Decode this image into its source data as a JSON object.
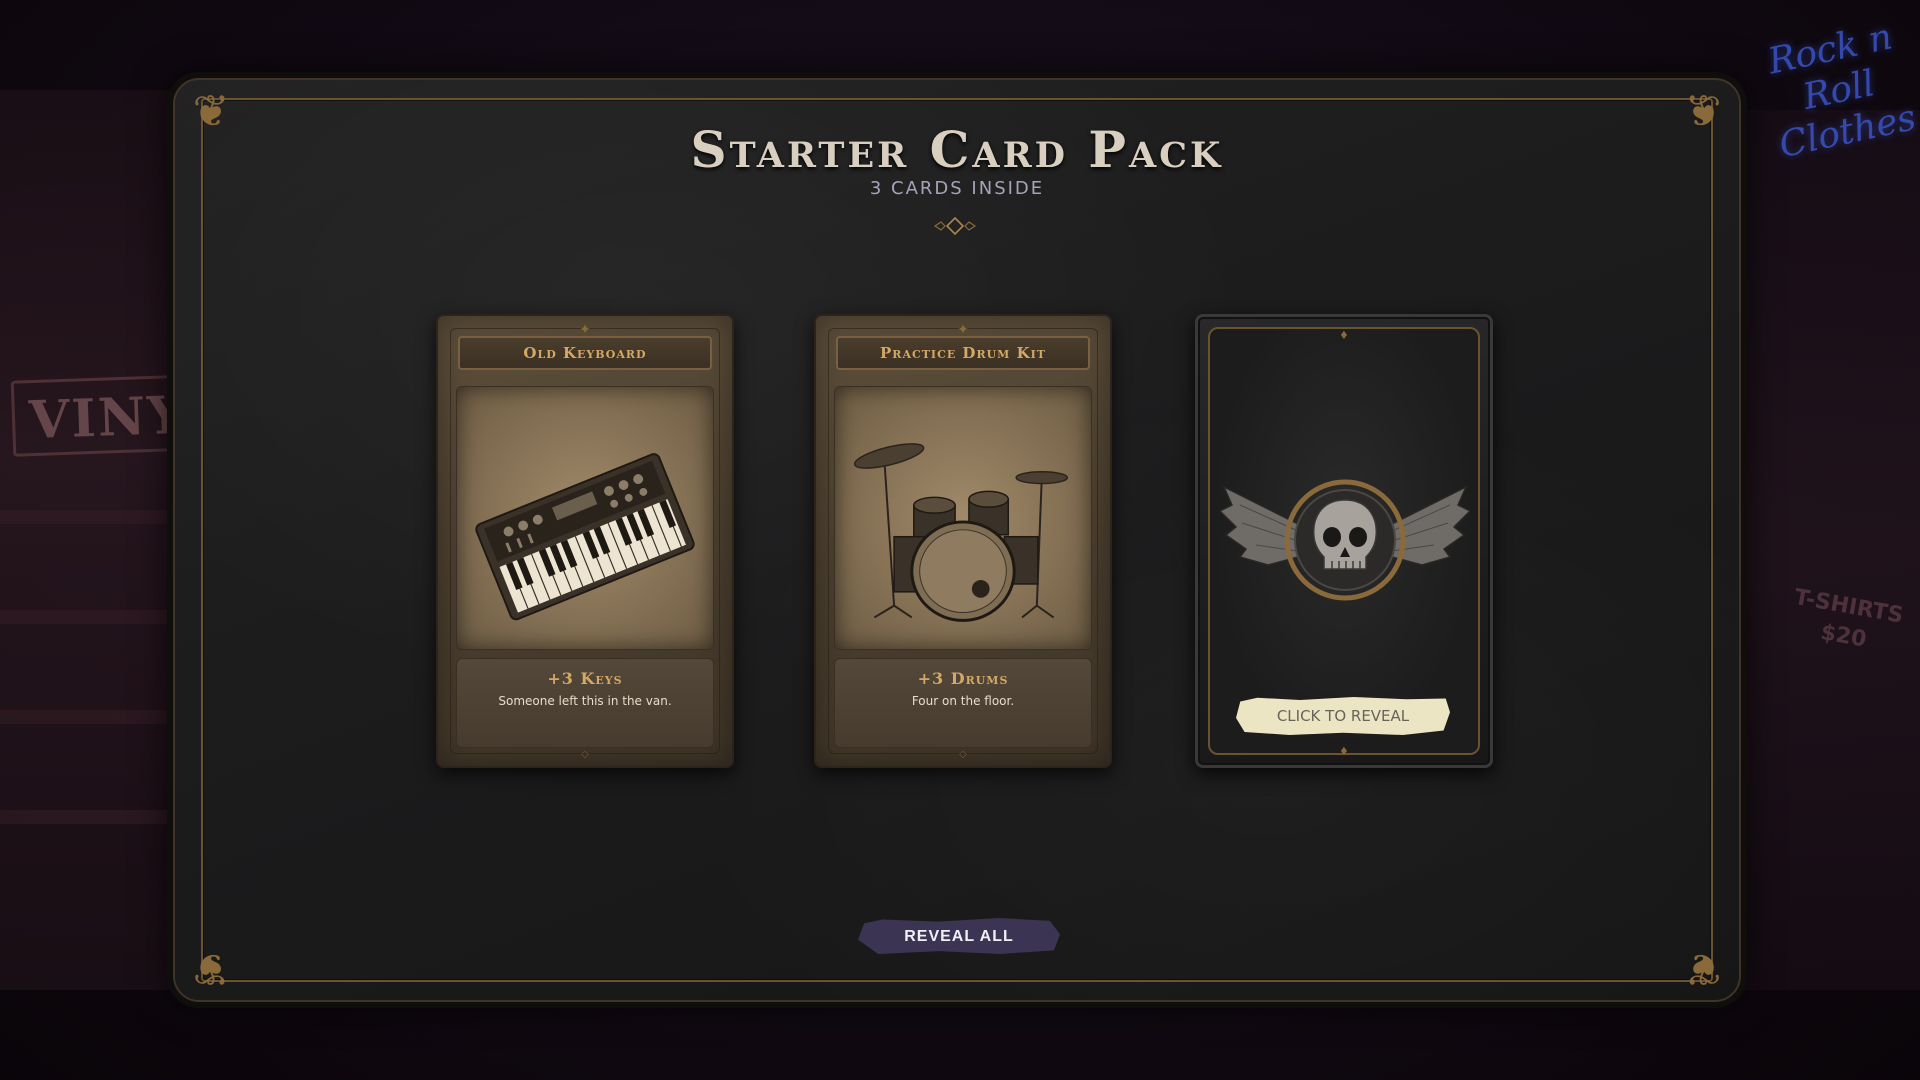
{
  "background": {
    "left_sign": "VINYL",
    "neon_sign": "Rock n Roll Clothes",
    "tshirt_sign": "T-SHIRTS $20"
  },
  "pack": {
    "title": "Starter Card Pack",
    "subtitle": "3 CARDS INSIDE"
  },
  "cards": [
    {
      "state": "revealed",
      "name": "Old Keyboard",
      "art_icon": "keyboard-synth-icon",
      "stat": "+3 Keys",
      "description": "Someone left this in the van."
    },
    {
      "state": "revealed",
      "name": "Practice Drum Kit",
      "art_icon": "drum-kit-icon",
      "stat": "+3 Drums",
      "description": "Four on the floor."
    },
    {
      "state": "hidden",
      "emblem_icon": "winged-skull-icon",
      "reveal_label": "CLICK TO REVEAL"
    }
  ],
  "actions": {
    "reveal_all_label": "REVEAL ALL"
  },
  "colors": {
    "accent_gold": "#d4a865",
    "frame_gold": "#6b5230",
    "button_purple": "#3b3452"
  }
}
